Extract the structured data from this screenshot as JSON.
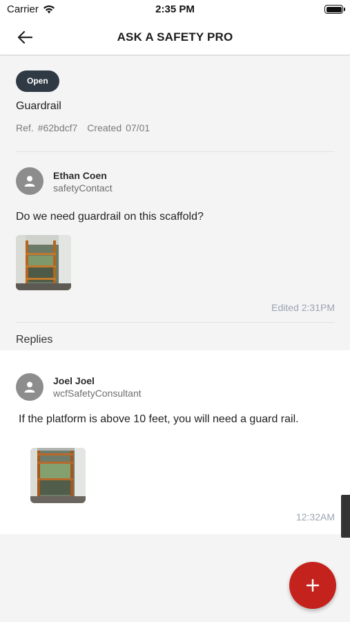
{
  "status_bar": {
    "carrier": "Carrier",
    "time": "2:35 PM",
    "icons": [
      "wifi-icon",
      "battery-icon"
    ]
  },
  "app_bar": {
    "title": "ASK A SAFETY PRO",
    "back_icon": "arrow-left-icon"
  },
  "question": {
    "status_badge": "Open",
    "title": "Guardrail",
    "ref_label": "Ref.",
    "ref_value": "#62bdcf7",
    "created_label": "Created",
    "created_value": "07/01",
    "author_name": "Ethan Coen",
    "author_role": "safetyContact",
    "body": "Do we need guardrail on this scaffold?",
    "timestamp": "Edited 2:31PM"
  },
  "replies_label": "Replies",
  "replies": [
    {
      "author_name": "Joel Joel",
      "author_role": "wcfSafetyConsultant",
      "body": "If the platform is above 10 feet, you will need a guard rail.",
      "timestamp": "12:32AM"
    }
  ],
  "fab": {
    "icon": "plus-icon"
  },
  "colors": {
    "badge": "#2f3a45",
    "fab": "#c4231d",
    "timestamp": "#9aa4b2",
    "avatar": "#8d8d8d"
  }
}
